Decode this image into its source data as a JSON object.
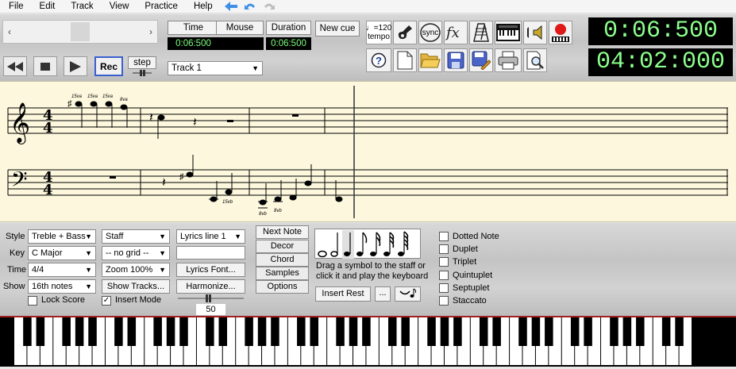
{
  "menu": [
    "File",
    "Edit",
    "Track",
    "View",
    "Practice",
    "Help"
  ],
  "scroller": {
    "left_arrow": "‹",
    "right_arrow": "›"
  },
  "transport": {
    "rec_label": "Rec",
    "step_label": "step"
  },
  "time_fields": {
    "time_label": "Time",
    "time_value": "0:06:500",
    "mouse_label": "Mouse",
    "mouse_value": "",
    "duration_label": "Duration",
    "duration_value": "0:06:500",
    "new_cue_label": "New cue"
  },
  "track_select": {
    "value": "Track 1"
  },
  "tempo": {
    "note": "♩=120",
    "label": "tempo"
  },
  "sync_label": "sync",
  "clocks": {
    "position": "0:06:500",
    "total": "04:02:000"
  },
  "staff": {
    "time_sig_top": "4",
    "time_sig_bottom": "4",
    "treble_octave_marks": [
      "15va",
      "15va",
      "15va",
      "8va"
    ],
    "bass_octave_marks": [
      "15vb",
      "8vb",
      "8vb"
    ]
  },
  "panel": {
    "style_label": "Style",
    "style_value": "Treble + Bass",
    "key_label": "Key",
    "key_value": "C Major",
    "time_label": "Time",
    "time_value": "4/4",
    "show_label": "Show",
    "show_value": "16th notes",
    "staff_value": "Staff",
    "grid_value": "-- no grid --",
    "zoom_value": "Zoom 100%",
    "show_tracks_label": "Show Tracks...",
    "lyrics_value": "Lyrics line 1",
    "lyrics_text": "",
    "lyrics_font_label": "Lyrics Font...",
    "harmonize_label": "Harmonize...",
    "slider_value": "50",
    "lock_score_label": "Lock Score",
    "lock_score_checked": false,
    "insert_mode_label": "Insert Mode",
    "insert_mode_checked": true,
    "stack_buttons": [
      "Next Note",
      "Decor",
      "Chord",
      "Samples",
      "Options"
    ],
    "drag_hint_1": "Drag a symbol to the staff or",
    "drag_hint_2": "click it and play the keyboard",
    "insert_rest_label": "Insert Rest",
    "more_label": "...",
    "modifiers": [
      {
        "label": "Dotted Note",
        "checked": false
      },
      {
        "label": "Duplet",
        "checked": false
      },
      {
        "label": "Triplet",
        "checked": false
      },
      {
        "label": "Quintuplet",
        "checked": false
      },
      {
        "label": "Septuplet",
        "checked": false
      },
      {
        "label": "Staccato",
        "checked": false
      }
    ]
  }
}
